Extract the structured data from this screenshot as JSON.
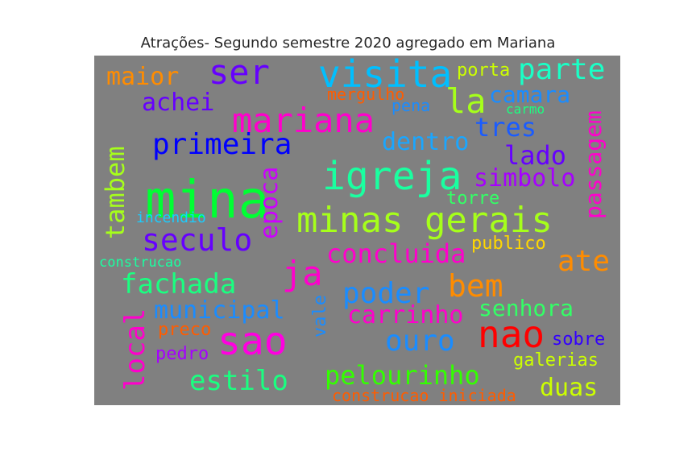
{
  "chart_data": {
    "type": "wordcloud",
    "title": "Atrações- Segundo semestre 2020 agregado em Mariana",
    "background": "#808080",
    "words": [
      {
        "text": "mina",
        "color": "#00ff33",
        "weight": 64
      },
      {
        "text": "minas gerais",
        "color": "#a6ff1a",
        "weight": 44
      },
      {
        "text": "igreja",
        "color": "#1affa0",
        "weight": 48
      },
      {
        "text": "visita",
        "color": "#00bfff",
        "weight": 46
      },
      {
        "text": "sao",
        "color": "#ff00e0",
        "weight": 48
      },
      {
        "text": "nao",
        "color": "#ff0000",
        "weight": 46
      },
      {
        "text": "mariana",
        "color": "#ff00cc",
        "weight": 42
      },
      {
        "text": "seculo",
        "color": "#6600ff",
        "weight": 38
      },
      {
        "text": "ser",
        "color": "#6600ff",
        "weight": 42
      },
      {
        "text": "primeira",
        "color": "#0000ff",
        "weight": 36
      },
      {
        "text": "ja",
        "color": "#ff00cc",
        "weight": 42
      },
      {
        "text": "la",
        "color": "#a6ff1a",
        "weight": 42
      },
      {
        "text": "parte",
        "color": "#1affc6",
        "weight": 36
      },
      {
        "text": "ate",
        "color": "#ff8c00",
        "weight": 36
      },
      {
        "text": "bem",
        "color": "#ff8c00",
        "weight": 38
      },
      {
        "text": "poder",
        "color": "#1a8cff",
        "weight": 36
      },
      {
        "text": "ouro",
        "color": "#1a8cff",
        "weight": 36
      },
      {
        "text": "pelourinho",
        "color": "#33ff00",
        "weight": 32
      },
      {
        "text": "estilo",
        "color": "#1aff80",
        "weight": 34
      },
      {
        "text": "fachada",
        "color": "#1aff80",
        "weight": 34
      },
      {
        "text": "concluida",
        "color": "#ff00cc",
        "weight": 32
      },
      {
        "text": "tambem",
        "color": "#a6ff1a",
        "weight": 32
      },
      {
        "text": "local",
        "color": "#ff00cc",
        "weight": 34
      },
      {
        "text": "epoca",
        "color": "#cc00ff",
        "weight": 30
      },
      {
        "text": "passagem",
        "color": "#ff00cc",
        "weight": 28
      },
      {
        "text": "municipal",
        "color": "#1a8cff",
        "weight": 30
      },
      {
        "text": "carrinho",
        "color": "#ff00cc",
        "weight": 30
      },
      {
        "text": "tres",
        "color": "#1a5cff",
        "weight": 32
      },
      {
        "text": "lado",
        "color": "#6600ff",
        "weight": 32
      },
      {
        "text": "simbolo",
        "color": "#a600ff",
        "weight": 30
      },
      {
        "text": "dentro",
        "color": "#1aa6ff",
        "weight": 30
      },
      {
        "text": "camara",
        "color": "#1a8cff",
        "weight": 28
      },
      {
        "text": "achei",
        "color": "#6600ff",
        "weight": 30
      },
      {
        "text": "maior",
        "color": "#ff8c00",
        "weight": 30
      },
      {
        "text": "senhora",
        "color": "#33ff66",
        "weight": 28
      },
      {
        "text": "duas",
        "color": "#ccff00",
        "weight": 30
      },
      {
        "text": "vale",
        "color": "#1a8cff",
        "weight": 22
      },
      {
        "text": "porta",
        "color": "#ccff00",
        "weight": 22
      },
      {
        "text": "mergulho",
        "color": "#ff5c00",
        "weight": 20
      },
      {
        "text": "pena",
        "color": "#1a8cff",
        "weight": 20
      },
      {
        "text": "carmo",
        "color": "#1aff80",
        "weight": 16
      },
      {
        "text": "torre",
        "color": "#33ff66",
        "weight": 22
      },
      {
        "text": "publico",
        "color": "#ffd700",
        "weight": 22
      },
      {
        "text": "incendio",
        "color": "#1acdff",
        "weight": 18
      },
      {
        "text": "construcao",
        "color": "#1affa0",
        "weight": 17
      },
      {
        "text": "preco",
        "color": "#ff5c00",
        "weight": 22
      },
      {
        "text": "pedro",
        "color": "#a600ff",
        "weight": 22
      },
      {
        "text": "sobre",
        "color": "#3300ff",
        "weight": 22
      },
      {
        "text": "galerias",
        "color": "#ccff00",
        "weight": 22
      },
      {
        "text": "construcao iniciada",
        "color": "#ff5c00",
        "weight": 20
      }
    ]
  }
}
